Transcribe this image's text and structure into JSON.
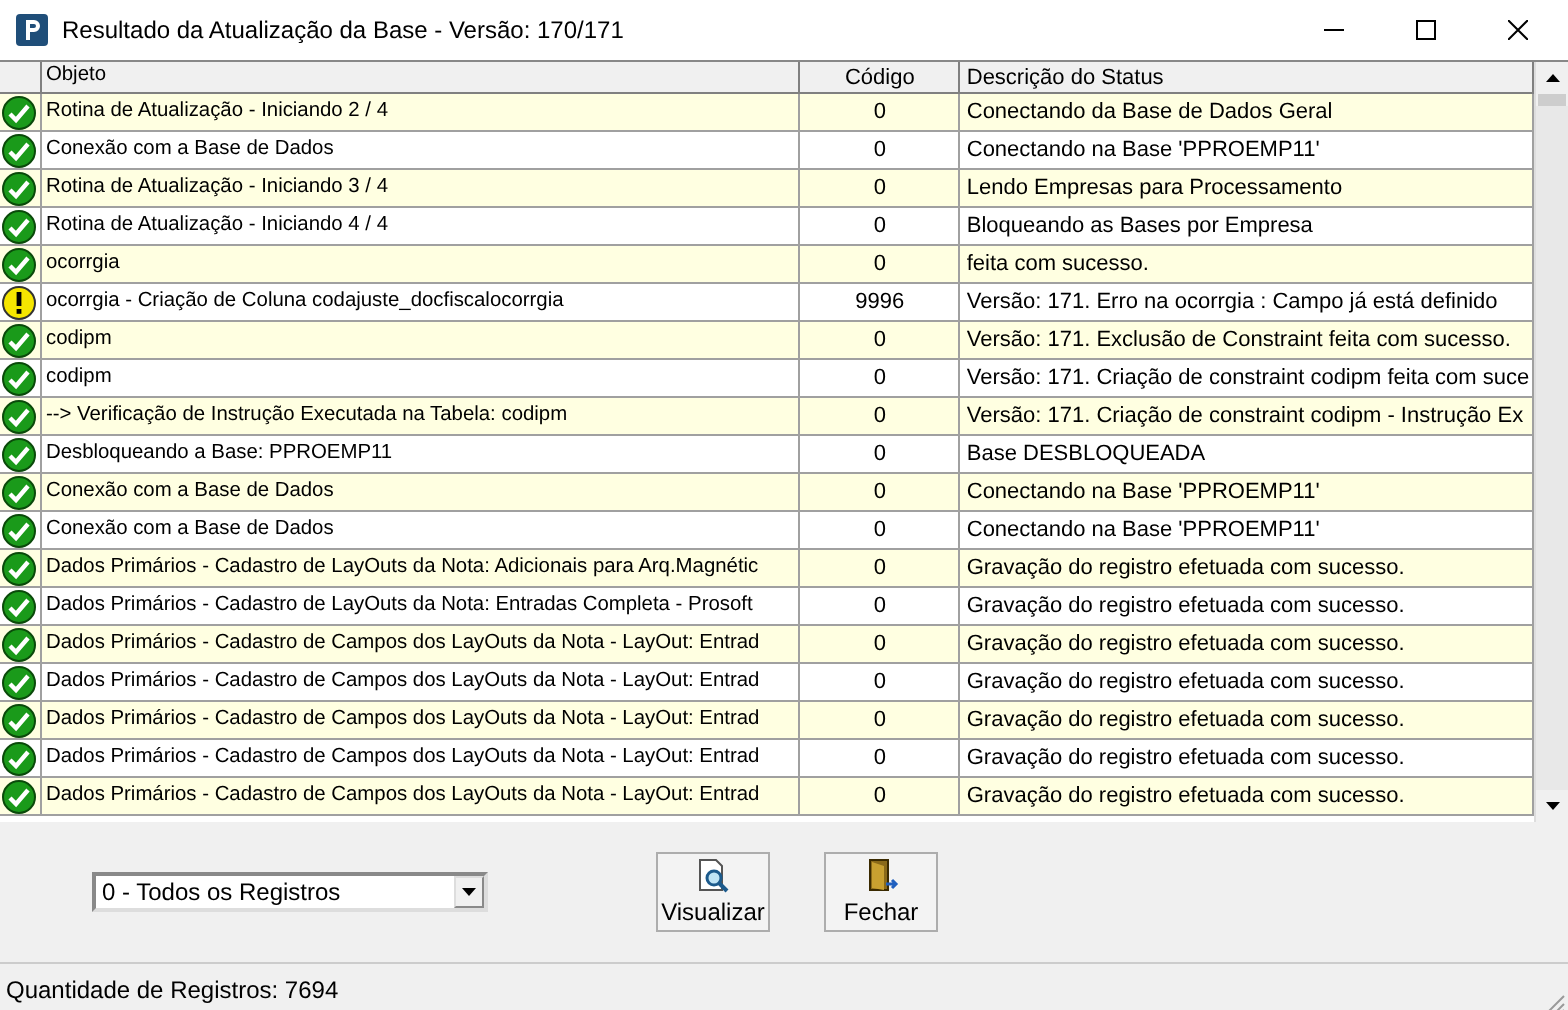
{
  "window": {
    "title": "Resultado da Atualização da Base - Versão: 170/171"
  },
  "table": {
    "columns": [
      "Objeto",
      "Código",
      "Descrição do Status"
    ],
    "rows": [
      {
        "kind": "ok",
        "object": "Rotina de Atualização - Iniciando 2 / 4",
        "code": "0",
        "status": "Conectando da Base de Dados Geral"
      },
      {
        "kind": "ok",
        "object": "Conexão com a Base de Dados",
        "code": "0",
        "status": "Conectando na Base 'PPROEMP11'"
      },
      {
        "kind": "ok",
        "object": "Rotina de Atualização - Iniciando 3 / 4",
        "code": "0",
        "status": "Lendo Empresas para Processamento"
      },
      {
        "kind": "ok",
        "object": "Rotina de Atualização - Iniciando 4 / 4",
        "code": "0",
        "status": "Bloqueando as Bases por Empresa"
      },
      {
        "kind": "ok",
        "object": "ocorrgia",
        "code": "0",
        "status": "feita com sucesso."
      },
      {
        "kind": "warning",
        "object": "ocorrgia - Criação de Coluna codajuste_docfiscalocorrgia",
        "code": "9996",
        "status": "Versão: 171. Erro na ocorrgia : Campo já está definido"
      },
      {
        "kind": "ok",
        "object": "codipm",
        "code": "0",
        "status": "Versão: 171. Exclusão de Constraint feita com sucesso."
      },
      {
        "kind": "ok",
        "object": "codipm",
        "code": "0",
        "status": "Versão: 171. Criação de constraint codipm feita com suce"
      },
      {
        "kind": "ok",
        "object": "--> Verificação de Instrução Executada na Tabela: codipm",
        "code": "0",
        "status": "Versão: 171. Criação de constraint codipm - Instrução Ex"
      },
      {
        "kind": "ok",
        "object": "Desbloqueando a Base: PPROEMP11",
        "code": "0",
        "status": "Base DESBLOQUEADA"
      },
      {
        "kind": "ok",
        "object": "Conexão com a Base de Dados",
        "code": "0",
        "status": "Conectando na Base 'PPROEMP11'"
      },
      {
        "kind": "ok",
        "object": "Conexão com a Base de Dados",
        "code": "0",
        "status": "Conectando na Base 'PPROEMP11'"
      },
      {
        "kind": "ok",
        "object": "Dados Primários - Cadastro de LayOuts da Nota: Adicionais para Arq.Magnétic",
        "code": "0",
        "status": "Gravação do registro efetuada com sucesso."
      },
      {
        "kind": "ok",
        "object": "Dados Primários - Cadastro de LayOuts da Nota: Entradas Completa - Prosoft",
        "code": "0",
        "status": "Gravação do registro efetuada com sucesso."
      },
      {
        "kind": "ok",
        "object": "Dados Primários - Cadastro de Campos dos LayOuts da Nota - LayOut: Entrad",
        "code": "0",
        "status": "Gravação do registro efetuada com sucesso."
      },
      {
        "kind": "ok",
        "object": "Dados Primários - Cadastro de Campos dos LayOuts da Nota - LayOut: Entrad",
        "code": "0",
        "status": "Gravação do registro efetuada com sucesso."
      },
      {
        "kind": "ok",
        "object": "Dados Primários - Cadastro de Campos dos LayOuts da Nota - LayOut: Entrad",
        "code": "0",
        "status": "Gravação do registro efetuada com sucesso."
      },
      {
        "kind": "ok",
        "object": "Dados Primários - Cadastro de Campos dos LayOuts da Nota - LayOut: Entrad",
        "code": "0",
        "status": "Gravação do registro efetuada com sucesso."
      },
      {
        "kind": "ok",
        "object": "Dados Primários - Cadastro de Campos dos LayOuts da Nota - LayOut: Entrad",
        "code": "0",
        "status": "Gravação do registro efetuada com sucesso."
      }
    ]
  },
  "filter": {
    "value": "0 - Todos os Registros"
  },
  "buttons": [
    "Visualizar",
    "Fechar"
  ],
  "status_bar": "Quantidade de Registros: 7694"
}
